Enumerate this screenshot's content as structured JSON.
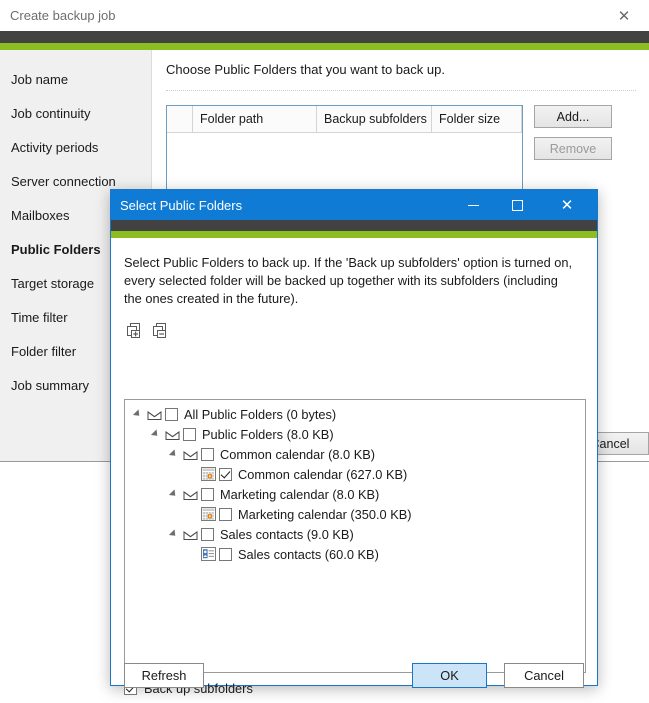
{
  "background_window": {
    "title": "Create backup job",
    "close_icon": "close-icon",
    "sidebar": {
      "items": [
        {
          "label": "Job name",
          "active": false
        },
        {
          "label": "Job continuity",
          "active": false
        },
        {
          "label": "Activity periods",
          "active": false
        },
        {
          "label": "Server connection",
          "active": false
        },
        {
          "label": "Mailboxes",
          "active": false
        },
        {
          "label": "Public Folders",
          "active": true
        },
        {
          "label": "Target storage",
          "active": false
        },
        {
          "label": "Time filter",
          "active": false
        },
        {
          "label": "Folder filter",
          "active": false
        },
        {
          "label": "Job summary",
          "active": false
        }
      ]
    },
    "content": {
      "instruction": "Choose Public Folders that you want to back up.",
      "table": {
        "columns": [
          "",
          "Folder path",
          "Backup subfolders",
          "Folder size"
        ],
        "rows": []
      },
      "buttons": {
        "add": "Add...",
        "remove": "Remove",
        "cancel": "Cancel"
      }
    }
  },
  "dialog": {
    "title": "Select Public Folders",
    "window_controls": {
      "minimize": "minimize-icon",
      "maximize": "maximize-icon",
      "close": "close-icon"
    },
    "description": "Select Public Folders to back up. If the 'Back up subfolders' option is turned on, every selected folder will be backed up together with its subfolders (including the ones created in the future).",
    "toolbar": [
      {
        "name": "expand-all-icon",
        "tooltip": "Expand all"
      },
      {
        "name": "collapse-all-icon",
        "tooltip": "Collapse all"
      }
    ],
    "tree": [
      {
        "label": "All Public Folders (0 bytes)",
        "depth": 0,
        "icon": "folder-envelope-icon",
        "checked": false,
        "expandable": true
      },
      {
        "label": "Public Folders (8.0 KB)",
        "depth": 1,
        "icon": "folder-envelope-icon",
        "checked": false,
        "expandable": true
      },
      {
        "label": "Common calendar (8.0 KB)",
        "depth": 2,
        "icon": "folder-envelope-icon",
        "checked": false,
        "expandable": true
      },
      {
        "label": "Common calendar (627.0 KB)",
        "depth": 3,
        "icon": "calendar-icon",
        "checked": true,
        "expandable": false
      },
      {
        "label": "Marketing calendar  (8.0 KB)",
        "depth": 2,
        "icon": "folder-envelope-icon",
        "checked": false,
        "expandable": true
      },
      {
        "label": "Marketing calendar (350.0 KB)",
        "depth": 3,
        "icon": "calendar-icon",
        "checked": false,
        "expandable": false
      },
      {
        "label": "Sales contacts (9.0 KB)",
        "depth": 2,
        "icon": "folder-envelope-icon",
        "checked": false,
        "expandable": true
      },
      {
        "label": "Sales contacts (60.0 KB)",
        "depth": 3,
        "icon": "contacts-icon",
        "checked": false,
        "expandable": false
      }
    ],
    "subfolders_option": {
      "label": "Back up subfolders",
      "checked": true
    },
    "footer": {
      "refresh": "Refresh",
      "ok": "OK",
      "cancel": "Cancel"
    }
  },
  "colors": {
    "accent_blue": "#0f7bd4",
    "dark_bar": "#424242",
    "green_bar": "#8cbe22",
    "ok_button_fill": "#cce4f7",
    "sidebar_bg": "#f0f0f0"
  }
}
